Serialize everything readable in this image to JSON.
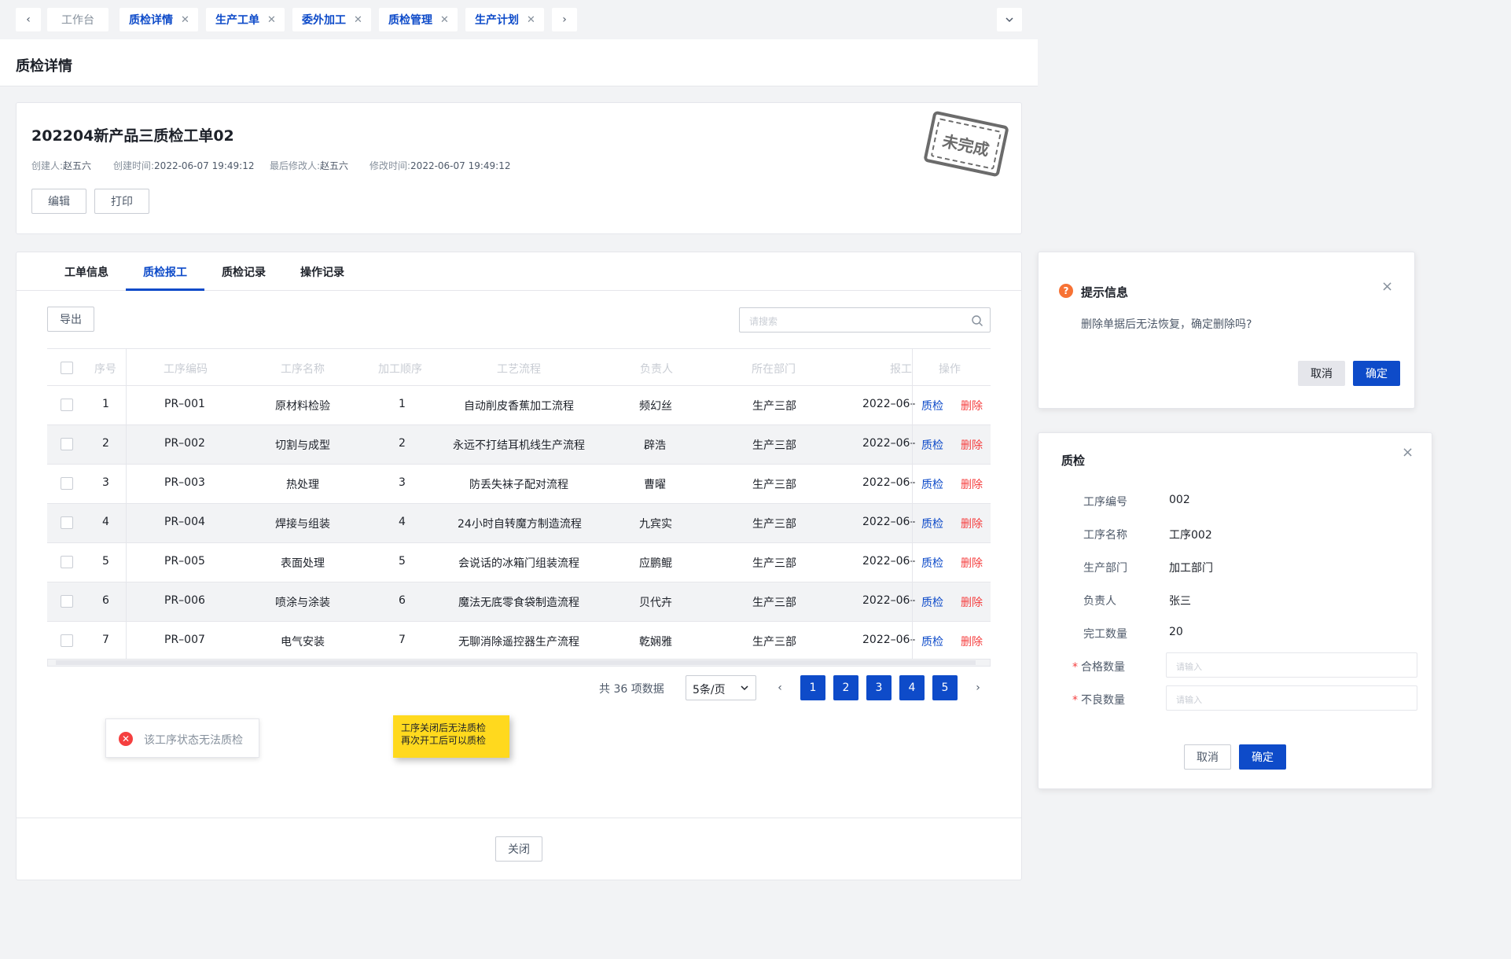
{
  "tabs": {
    "home": "工作台",
    "items": [
      "质检详情",
      "生产工单",
      "委外加工",
      "质检管理",
      "生产计划"
    ]
  },
  "header": {
    "title": "质检详情"
  },
  "order": {
    "title": "202204新产品三质检工单02",
    "creator_label": "创建人:",
    "creator": "赵五六",
    "created_label": "创建时间:",
    "created": "2022-06-07 19:49:12",
    "modifier_label": "最后修改人:",
    "modifier": "赵五六",
    "modified_label": "修改时间:",
    "modified": "2022-06-07 19:49:12",
    "edit_label": "编辑",
    "print_label": "打印",
    "stamp": "未完成"
  },
  "content_tabs": [
    "工单信息",
    "质检报工",
    "质检记录",
    "操作记录"
  ],
  "toolbar": {
    "export_label": "导出",
    "search_placeholder": "请搜索"
  },
  "table": {
    "headers": [
      "序号",
      "工序编码",
      "工序名称",
      "加工顺序",
      "工艺流程",
      "负责人",
      "所在部门",
      "报工",
      "操作"
    ],
    "rows": [
      [
        "1",
        "PR–001",
        "原材料检验",
        "1",
        "自动削皮香蕉加工流程",
        "频幻丝",
        "生产三部",
        "2022–06–"
      ],
      [
        "2",
        "PR–002",
        "切割与成型",
        "2",
        "永远不打结耳机线生产流程",
        "辟浩",
        "生产三部",
        "2022–06–"
      ],
      [
        "3",
        "PR–003",
        "热处理",
        "3",
        "防丢失袜子配对流程",
        "曹曜",
        "生产三部",
        "2022–06–"
      ],
      [
        "4",
        "PR–004",
        "焊接与组装",
        "4",
        "24小时自转魔方制造流程",
        "九宾实",
        "生产三部",
        "2022–06–"
      ],
      [
        "5",
        "PR–005",
        "表面处理",
        "5",
        "会说话的冰箱门组装流程",
        "应鹏鲲",
        "生产三部",
        "2022–06–"
      ],
      [
        "6",
        "PR–006",
        "喷涂与涂装",
        "6",
        "魔法无底零食袋制造流程",
        "贝代卉",
        "生产三部",
        "2022–06–"
      ],
      [
        "7",
        "PR–007",
        "电气安装",
        "7",
        "无聊消除遥控器生产流程",
        "乾娴雅",
        "生产三部",
        "2022–06–"
      ]
    ],
    "action_check": "质检",
    "action_delete": "删除"
  },
  "pagination": {
    "total": "共 36 项数据",
    "page_size": "5条/页",
    "pages": [
      "1",
      "2",
      "3",
      "4",
      "5"
    ]
  },
  "toast": {
    "text": "该工序状态无法质检"
  },
  "note": {
    "line1": "工序关闭后无法质检",
    "line2": "再次开工后可以质检"
  },
  "footer": {
    "close_label": "关闭"
  },
  "confirm_dialog": {
    "title": "提示信息",
    "message": "删除单据后无法恢复，确定删除吗?",
    "cancel_label": "取消",
    "ok_label": "确定"
  },
  "qc_dialog": {
    "title": "质检",
    "fields": [
      {
        "label": "工序编号",
        "value": "002"
      },
      {
        "label": "工序名称",
        "value": "工序002"
      },
      {
        "label": "生产部门",
        "value": "加工部门"
      },
      {
        "label": "负责人",
        "value": "张三"
      },
      {
        "label": "完工数量",
        "value": "20"
      }
    ],
    "qualified_label": "合格数量",
    "defective_label": "不良数量",
    "input_placeholder": "请输入",
    "required_mark": "*",
    "cancel_label": "取消",
    "ok_label": "确定"
  },
  "colors": {
    "primary": "#0e4bc9",
    "danger": "#f53f3f",
    "warning": "#f77234",
    "note": "#ffd91e"
  }
}
